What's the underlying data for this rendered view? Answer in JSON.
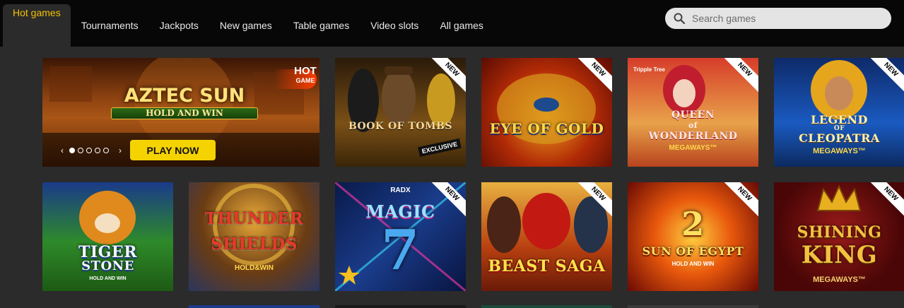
{
  "nav": {
    "tabs": [
      {
        "label": "Hot games",
        "active": true
      },
      {
        "label": "Tournaments"
      },
      {
        "label": "Jackpots"
      },
      {
        "label": "New games"
      },
      {
        "label": "Table games"
      },
      {
        "label": "Video slots"
      },
      {
        "label": "All games"
      }
    ],
    "search": {
      "placeholder": "Search games",
      "icon": "search-icon"
    }
  },
  "hero": {
    "game_title_line1": "AZTEC SUN",
    "game_title_line2": "HOLD AND WIN",
    "hot_badge_line1": "HOT",
    "hot_badge_line2": "GAME",
    "prev_label": "‹",
    "next_label": "›",
    "slide_count": 5,
    "active_slide": 1,
    "play_label": "PLAY NOW"
  },
  "badges": {
    "new": "NEW",
    "exclusive": "EXCLUSIVE"
  },
  "games": {
    "row1": [
      {
        "title": "BOOK OF TOMBS",
        "new": true,
        "exclusive": "EXCLUSIVE"
      },
      {
        "title": "EYE OF GOLD",
        "new": true
      },
      {
        "brand": "Tripple Tree",
        "title1": "QUEEN",
        "title2": "of",
        "title3": "WONDERLAND",
        "sub": "MEGAWAYS™",
        "new": true
      },
      {
        "title1": "LEGEND",
        "title2": "OF",
        "title3": "CLEOPATRA",
        "sub": "MEGAWAYS™",
        "new": true
      }
    ],
    "row2": [
      {
        "title1": "TIGER",
        "title2": "STONE",
        "sub": "HOLD AND WIN"
      },
      {
        "title1": "THUNDER",
        "title2": "SHIELDS",
        "sub": "HOLD&WIN"
      },
      {
        "brand": "RADX",
        "title": "MAGIC",
        "number": "7",
        "new": true
      },
      {
        "title": "BEAST SAGA",
        "new": true
      },
      {
        "number": "2",
        "title": "SUN OF EGYPT",
        "sub": "HOLD AND WIN",
        "new": true
      },
      {
        "title1": "SHINING",
        "title2": "KING",
        "sub": "MEGAWAYS™",
        "new": true
      }
    ]
  },
  "colors": {
    "accent": "#f2c200",
    "background": "#2b2b2b",
    "topbar": "#070707",
    "play": "#f5d300"
  }
}
